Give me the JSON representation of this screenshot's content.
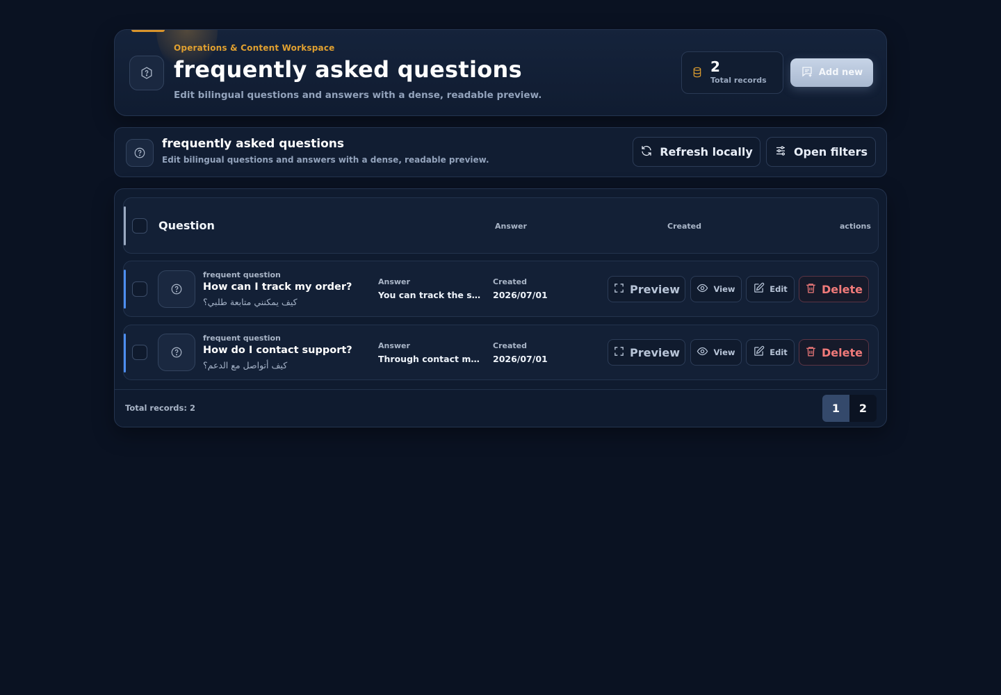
{
  "hero": {
    "eyebrow": "Operations & Content Workspace",
    "title": "frequently asked questions",
    "subtitle": "Edit bilingual questions and answers with a dense, readable preview.",
    "stat_value": "2",
    "stat_label": "Total records",
    "add_label": "Add new"
  },
  "subheader": {
    "title": "frequently asked questions",
    "subtitle": "Edit bilingual questions and answers with a dense, readable preview.",
    "refresh_label": "Refresh locally",
    "filters_label": "Open filters"
  },
  "table": {
    "columns": {
      "question": "Question",
      "answer": "Answer",
      "created": "Created",
      "actions": "actions"
    },
    "rows": [
      {
        "eyebrow": "frequent question",
        "question": "How can I track my order?",
        "question_ar": "كيف يمكنني متابعة طلبي؟",
        "answer_label": "Answer",
        "answer": "You can track the st...",
        "created_label": "Created",
        "created": "2026/07/01"
      },
      {
        "eyebrow": "frequent question",
        "question": "How do I contact support?",
        "question_ar": "كيف أتواصل مع الدعم؟",
        "answer_label": "Answer",
        "answer": "Through contact me...",
        "created_label": "Created",
        "created": "2026/07/01"
      }
    ],
    "actions": {
      "preview": "Preview",
      "view": "View",
      "edit": "Edit",
      "delete": "Delete"
    },
    "total_text": "Total records: 2",
    "pages": [
      "1",
      "2"
    ],
    "current_page": "1"
  },
  "colors": {
    "background": "#0a1222",
    "accent": "#e0a030",
    "row_bar": "#4d8ef0",
    "danger": "#f07a7a"
  },
  "icons": {
    "hero": "hexagon-question-icon",
    "stat": "database-icon",
    "add": "message-plus-icon",
    "subheader": "help-circle-icon",
    "refresh": "refresh-icon",
    "filters": "sliders-icon",
    "row": "help-circle-icon",
    "preview": "fullscreen-icon",
    "view": "eye-icon",
    "edit": "pencil-icon",
    "delete": "trash-icon"
  }
}
